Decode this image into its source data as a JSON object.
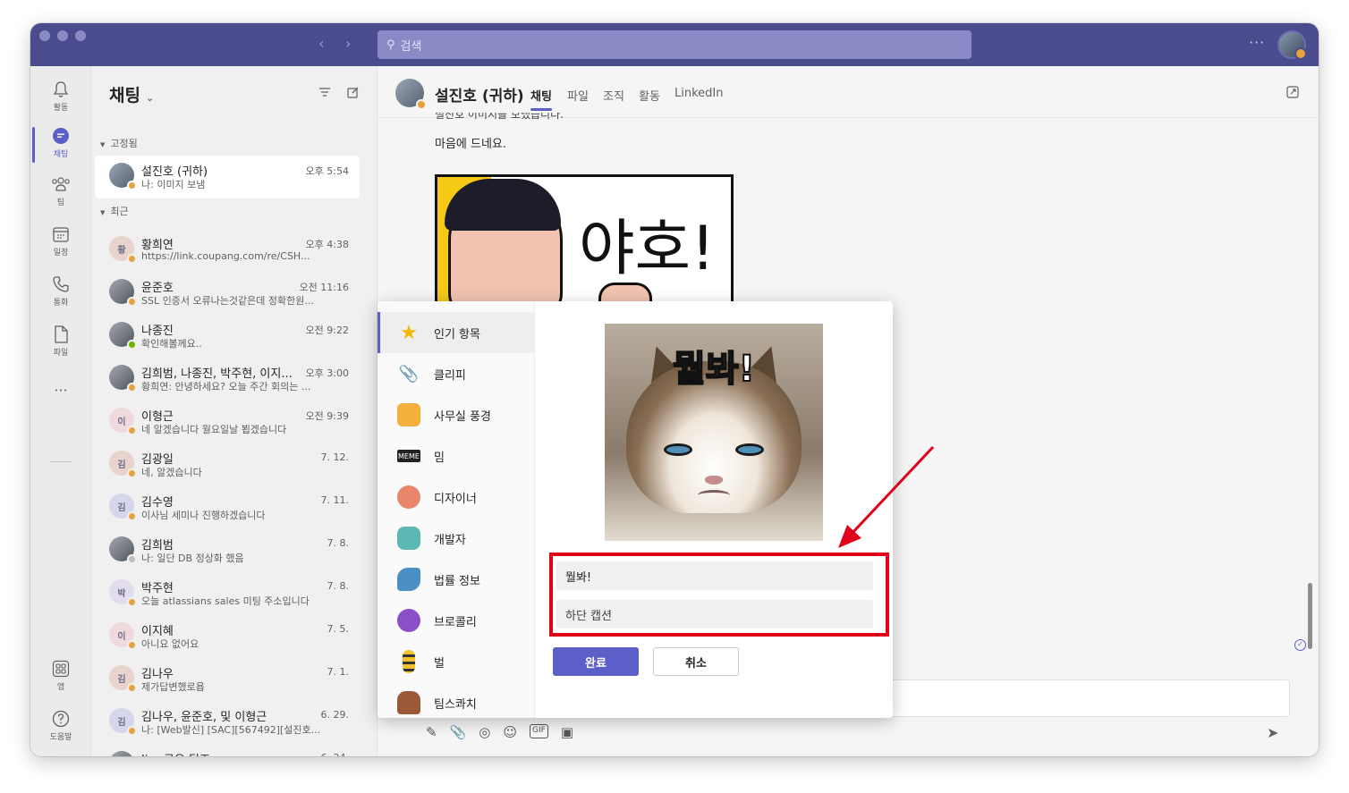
{
  "titlebar": {
    "search_placeholder": "검색",
    "more": "···"
  },
  "rail": {
    "items": [
      {
        "label": "활동",
        "icon": "bell-icon"
      },
      {
        "label": "채팅",
        "icon": "chat-icon"
      },
      {
        "label": "팀",
        "icon": "teams-icon"
      },
      {
        "label": "일정",
        "icon": "calendar-icon"
      },
      {
        "label": "통화",
        "icon": "phone-icon"
      },
      {
        "label": "파일",
        "icon": "file-icon"
      }
    ],
    "more": "···",
    "apps": "앱",
    "help": "도움말"
  },
  "chatlist": {
    "title": "채팅",
    "pinned_section": "고정됨",
    "recent_section": "최근",
    "pinned": [
      {
        "name": "설진호 (귀하)",
        "time": "오후 5:54",
        "preview": "나: 이미지 보냄"
      }
    ],
    "recent": [
      {
        "name": "황희연",
        "time": "오후 4:38",
        "preview": "https://link.coupang.com/re/CSH...",
        "initial": "황"
      },
      {
        "name": "윤준호",
        "time": "오전 11:16",
        "preview": "SSL 인증서 오류나는것같은데 정확한원...",
        "initial": ""
      },
      {
        "name": "나종진",
        "time": "오전 9:22",
        "preview": "확인해볼께요..",
        "initial": ""
      },
      {
        "name": "김희범, 나종진, 박주현, 이지...",
        "time": "오후 3:00",
        "preview": "황희연: 안녕하세요? 오늘 주간 회의는 ...",
        "initial": ""
      },
      {
        "name": "이형근",
        "time": "오전 9:39",
        "preview": "네 알겠습니다 월요일날 뵙겠습니다",
        "initial": "이"
      },
      {
        "name": "김광일",
        "time": "7. 12.",
        "preview": "네, 알겠습니다",
        "initial": "김"
      },
      {
        "name": "김수영",
        "time": "7. 11.",
        "preview": "이사님 세미나 진행하겠습니다",
        "initial": "김"
      },
      {
        "name": "김희범",
        "time": "7. 8.",
        "preview": "나: 일단 DB 정상화 했음",
        "initial": ""
      },
      {
        "name": "박주현",
        "time": "7. 8.",
        "preview": "오늘 atlassians sales 미팅 주소입니다",
        "initial": "박"
      },
      {
        "name": "이지혜",
        "time": "7. 5.",
        "preview": "아니요 없어요",
        "initial": "이"
      },
      {
        "name": "김나우",
        "time": "7. 1.",
        "preview": "제가답변했로욥",
        "initial": "김"
      },
      {
        "name": "김나우, 윤준호, 및 이형근",
        "time": "6. 29.",
        "preview": "나: [Web발신] [SAC][567492][설진호...",
        "initial": "김"
      },
      {
        "name": "Jira 공유 팀즈",
        "time": "6. 24.",
        "preview": "",
        "initial": ""
      }
    ]
  },
  "main": {
    "contact_name": "설진호 (귀하)",
    "tabs": [
      "채팅",
      "파일",
      "조직",
      "활동",
      "LinkedIn"
    ],
    "message_fragment": "설진호 이미지를 보냈습니다.",
    "message_text": "마음에 드네요.",
    "sticker_text": "야호!"
  },
  "picker": {
    "categories": [
      {
        "label": "인기 항목",
        "icon": "star-icon"
      },
      {
        "label": "클리피",
        "icon": "paperclip-icon"
      },
      {
        "label": "사무실 풍경",
        "icon": "office-icon"
      },
      {
        "label": "밈",
        "icon": "meme-icon"
      },
      {
        "label": "디자이너",
        "icon": "designer-icon"
      },
      {
        "label": "개발자",
        "icon": "developer-icon"
      },
      {
        "label": "법률 정보",
        "icon": "legal-icon"
      },
      {
        "label": "브로콜리",
        "icon": "broccoli-icon"
      },
      {
        "label": "벌",
        "icon": "bee-icon"
      },
      {
        "label": "팀스콰치",
        "icon": "sasquatch-icon"
      }
    ],
    "meme_caption": "뭘봐!",
    "top_caption_value": "뭘봐!",
    "bottom_caption_placeholder": "하단 캡션",
    "done": "완료",
    "cancel": "취소"
  },
  "colors": {
    "titlebar": "#4b4c8e",
    "accent": "#5b5fc7",
    "highlight": "#e0001a"
  }
}
